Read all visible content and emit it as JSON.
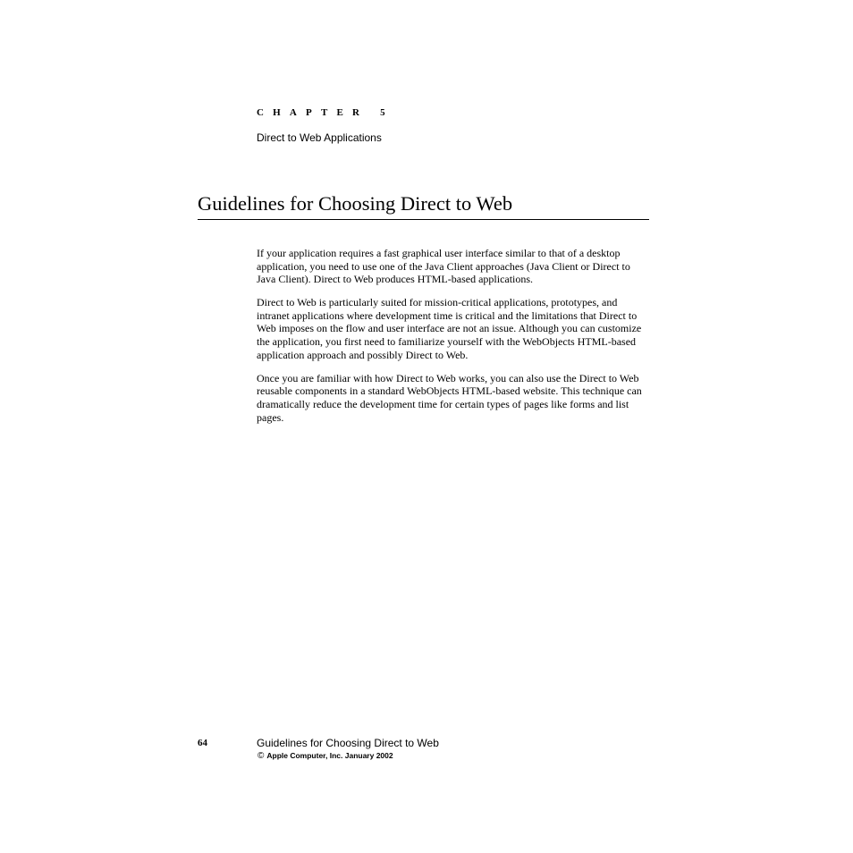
{
  "header": {
    "chapter_label": "CHAPTER 5",
    "chapter_title": "Direct to Web Applications"
  },
  "section": {
    "heading": "Guidelines for Choosing Direct to Web",
    "paragraphs": [
      "If your application requires a fast graphical user interface similar to that of a desktop application, you need to use one of the Java Client approaches (Java Client or Direct to Java Client). Direct to Web produces HTML-based applications.",
      "Direct to Web is particularly suited for mission-critical applications, prototypes, and intranet applications where development time is critical and the limitations that Direct to Web imposes on the flow and user interface are not an issue. Although you can customize the application, you first need to familiarize yourself with the WebObjects HTML-based application approach and possibly Direct to Web.",
      "Once you are familiar with how Direct to Web works, you can also use the Direct to Web reusable components in a standard WebObjects HTML-based website. This technique can dramatically reduce the development time for certain types of pages like forms and list pages."
    ]
  },
  "footer": {
    "page_number": "64",
    "title": "Guidelines for Choosing Direct to Web",
    "copyright_icon": "©",
    "copyright_text": "Apple Computer, Inc. January 2002"
  }
}
